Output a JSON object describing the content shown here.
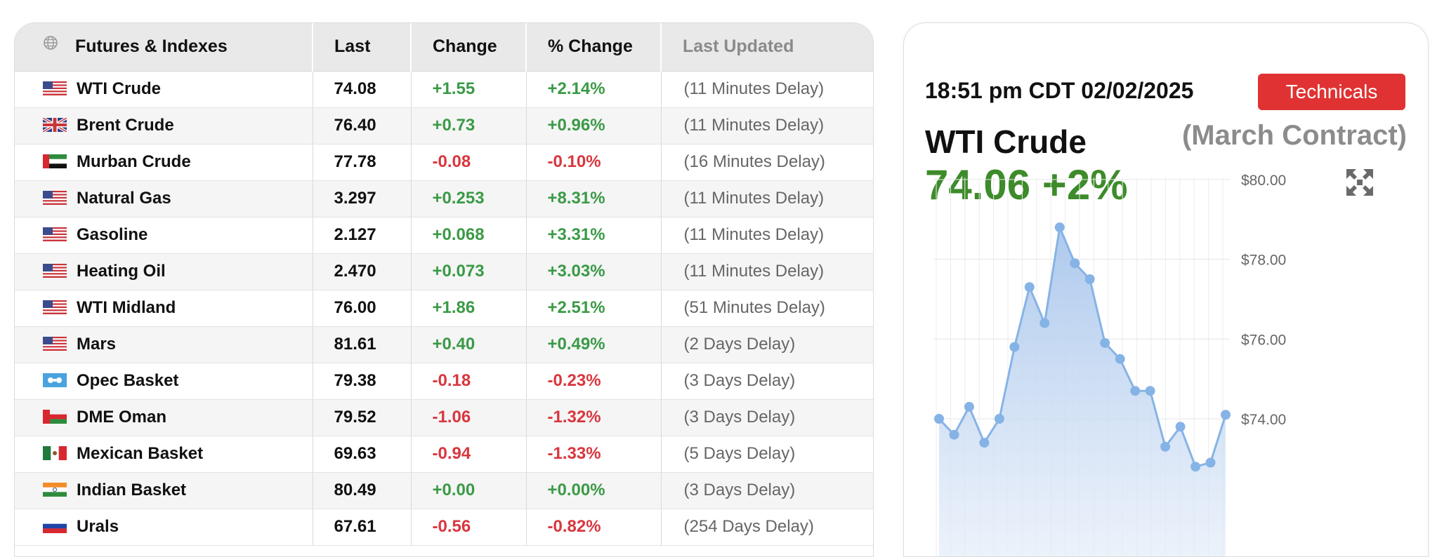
{
  "table": {
    "headers": {
      "name": "Futures & Indexes",
      "last": "Last",
      "change": "Change",
      "pct_change": "% Change",
      "updated": "Last Updated"
    },
    "rows": [
      {
        "flag": "us",
        "name": "WTI Crude",
        "last": "74.08",
        "change": "+1.55",
        "pct": "+2.14%",
        "dir": "up",
        "updated": "(11 Minutes Delay)"
      },
      {
        "flag": "uk",
        "name": "Brent Crude",
        "last": "76.40",
        "change": "+0.73",
        "pct": "+0.96%",
        "dir": "up",
        "updated": "(11 Minutes Delay)"
      },
      {
        "flag": "uae",
        "name": "Murban Crude",
        "last": "77.78",
        "change": "-0.08",
        "pct": "-0.10%",
        "dir": "down",
        "updated": "(16 Minutes Delay)"
      },
      {
        "flag": "us",
        "name": "Natural Gas",
        "last": "3.297",
        "change": "+0.253",
        "pct": "+8.31%",
        "dir": "up",
        "updated": "(11 Minutes Delay)"
      },
      {
        "flag": "us",
        "name": "Gasoline",
        "last": "2.127",
        "change": "+0.068",
        "pct": "+3.31%",
        "dir": "up",
        "updated": "(11 Minutes Delay)"
      },
      {
        "flag": "us",
        "name": "Heating Oil",
        "last": "2.470",
        "change": "+0.073",
        "pct": "+3.03%",
        "dir": "up",
        "updated": "(11 Minutes Delay)"
      },
      {
        "flag": "us",
        "name": "WTI Midland",
        "last": "76.00",
        "change": "+1.86",
        "pct": "+2.51%",
        "dir": "up",
        "updated": "(51 Minutes Delay)"
      },
      {
        "flag": "us",
        "name": "Mars",
        "last": "81.61",
        "change": "+0.40",
        "pct": "+0.49%",
        "dir": "up",
        "updated": "(2 Days Delay)"
      },
      {
        "flag": "opec",
        "name": "Opec Basket",
        "last": "79.38",
        "change": "-0.18",
        "pct": "-0.23%",
        "dir": "down",
        "updated": "(3 Days Delay)"
      },
      {
        "flag": "oman",
        "name": "DME Oman",
        "last": "79.52",
        "change": "-1.06",
        "pct": "-1.32%",
        "dir": "down",
        "updated": "(3 Days Delay)"
      },
      {
        "flag": "mexico",
        "name": "Mexican Basket",
        "last": "69.63",
        "change": "-0.94",
        "pct": "-1.33%",
        "dir": "down",
        "updated": "(5 Days Delay)"
      },
      {
        "flag": "india",
        "name": "Indian Basket",
        "last": "80.49",
        "change": "+0.00",
        "pct": "+0.00%",
        "dir": "up",
        "updated": "(3 Days Delay)"
      },
      {
        "flag": "russia",
        "name": "Urals",
        "last": "67.61",
        "change": "-0.56",
        "pct": "-0.82%",
        "dir": "down",
        "updated": "(254 Days Delay)"
      }
    ]
  },
  "card": {
    "timestamp": "18:51 pm CDT 02/02/2025",
    "technicals_label": "Technicals",
    "instrument": "WTI Crude",
    "contract": "(March Contract)",
    "price": "74.06 +2%",
    "expand_icon": "expand-arrows-icon"
  },
  "chart_data": {
    "type": "area",
    "title": "",
    "xlabel": "",
    "ylabel": "",
    "y_tick_labels": [
      "$80.00",
      "$78.00",
      "$76.00",
      "$74.00"
    ],
    "y_ticks": [
      80,
      78,
      76,
      74
    ],
    "ylim": [
      70.2,
      80.05
    ],
    "grid": true,
    "series": [
      {
        "values": [
          74.0,
          73.6,
          74.3,
          73.4,
          74.0,
          75.8,
          77.3,
          76.4,
          78.8,
          77.9,
          77.5,
          75.9,
          75.5,
          74.7,
          74.7,
          73.3,
          73.8,
          72.8,
          72.9,
          74.1
        ]
      }
    ],
    "line_color": "#86b3e6",
    "fill_color": "#bcd3ef"
  }
}
